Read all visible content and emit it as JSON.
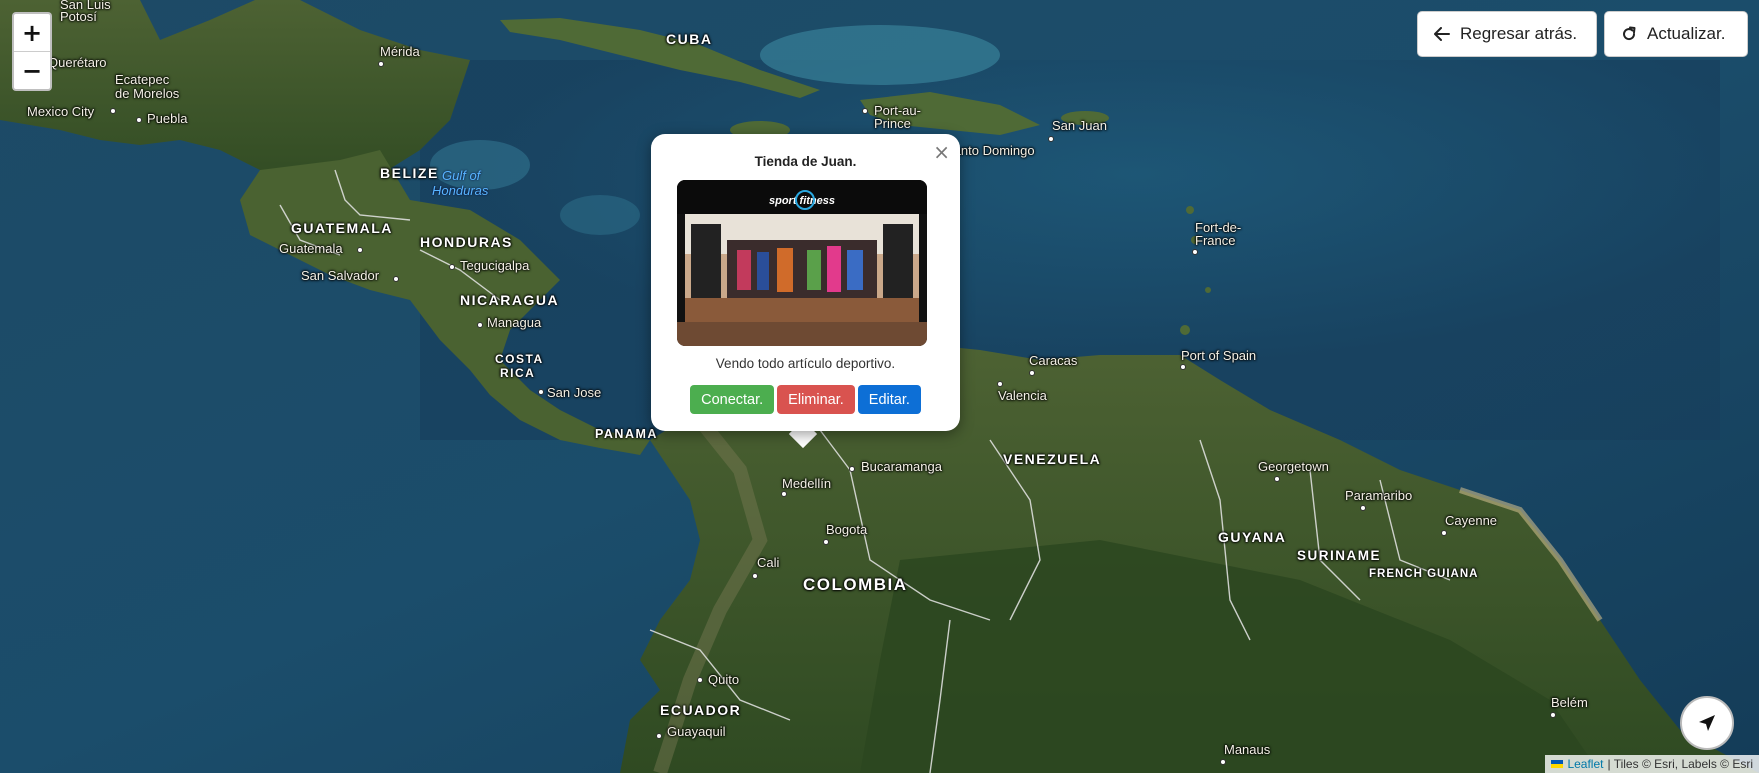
{
  "map": {
    "countries": {
      "cuba": "CUBA",
      "belize": "BELIZE",
      "guatemala": "GUATEMALA",
      "honduras": "HONDURAS",
      "nicaragua": "NICARAGUA",
      "costa_rica_1": "COSTA",
      "costa_rica_2": "RICA",
      "panama": "PANAMA",
      "venezuela": "VENEZUELA",
      "colombia": "COLOMBIA",
      "guyana": "GUYANA",
      "suriname": "SURINAME",
      "french_guiana": "FRENCH GUIANA",
      "ecuador": "ECUADOR"
    },
    "cities": {
      "san_luis_potosi_1": "San Luis",
      "san_luis_potosi_2": "Potosí",
      "queretaro": "Querétaro",
      "merida": "Mérida",
      "ecatepec_1": "Ecatepec",
      "ecatepec_2": "de Morelos",
      "mexico_city": "Mexico City",
      "puebla": "Puebla",
      "port_au_prince_1": "Port-au-",
      "port_au_prince_2": "Prince",
      "santo_domingo": "Santo Domingo",
      "san_juan": "San Juan",
      "fort_de_france_1": "Fort-de-",
      "fort_de_france_2": "France",
      "guatemala_city": "Guatemala",
      "tegucigalpa": "Tegucigalpa",
      "san_salvador": "San Salvador",
      "managua": "Managua",
      "san_jose": "San Jose",
      "caracas": "Caracas",
      "valencia": "Valencia",
      "port_of_spain": "Port of Spain",
      "bucaramanga": "Bucaramanga",
      "medellin": "Medellín",
      "georgetown": "Georgetown",
      "paramaribo": "Paramaribo",
      "cayenne": "Cayenne",
      "bogota": "Bogota",
      "cali": "Cali",
      "quito": "Quito",
      "guayaquil": "Guayaquil",
      "belem": "Belém",
      "manaus": "Manaus"
    },
    "water": {
      "gulf_1": "Gulf of",
      "gulf_2": "Honduras"
    }
  },
  "controls": {
    "zoom_in": "+",
    "zoom_out": "−",
    "back_label": "Regresar atrás.",
    "refresh_label": "Actualizar."
  },
  "popup": {
    "title": "Tienda de Juan.",
    "close": "×",
    "store_sign": "sport fitness",
    "description": "Vendo todo artículo deportivo.",
    "buttons": {
      "connect": "Conectar.",
      "delete": "Eliminar.",
      "edit": "Editar."
    },
    "colors": {
      "connect": "#4cae4f",
      "delete": "#d9534f",
      "edit": "#0d6fd6"
    }
  },
  "attribution": {
    "leaflet": "Leaflet",
    "rest": "| Tiles © Esri, Labels © Esri"
  }
}
